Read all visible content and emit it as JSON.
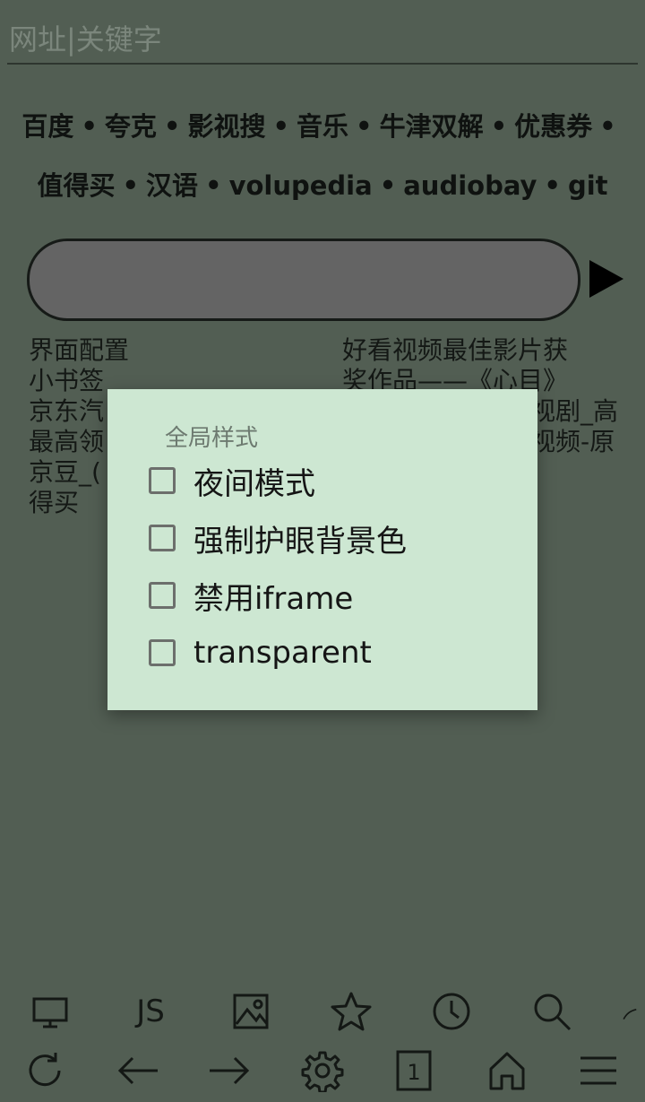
{
  "urlbar": {
    "placeholder": "网址|关键字"
  },
  "quicklinks": {
    "row1": [
      "百度",
      "夸克",
      "影视搜",
      "音乐",
      "牛津双解",
      "优惠券"
    ],
    "row2": [
      "值得买",
      "汉语",
      "volupedia",
      "audiobay",
      "git"
    ],
    "separator": "•"
  },
  "list_left": [
    "界面配置",
    "小书签",
    "京东汽",
    "最高领",
    "京豆_(",
    "得买"
  ],
  "list_right": [
    "好看视频最佳影片获",
    "奖作品——《心目》",
    "视剧_高",
    "视频-原"
  ],
  "dialog": {
    "title": "全局样式",
    "options": [
      {
        "label": "夜间模式",
        "checked": false
      },
      {
        "label": "强制护眼背景色",
        "checked": false
      },
      {
        "label": "禁用iframe",
        "checked": false
      },
      {
        "label": "transparent",
        "checked": false
      }
    ]
  },
  "toolbar_top": {
    "js_label": "JS",
    "icons": [
      "desktop-icon",
      "js-icon",
      "image-icon",
      "star-icon",
      "clock-icon",
      "search-icon",
      "more-icon"
    ]
  },
  "toolbar_bottom": {
    "tab_count": "1",
    "icons": [
      "refresh-icon",
      "back-arrow-icon",
      "forward-arrow-icon",
      "gear-icon",
      "tabs-icon",
      "home-icon",
      "menu-icon"
    ]
  },
  "colors": {
    "background": "#525e53",
    "dialog_bg": "#cde7d2",
    "search_fill": "#646464"
  }
}
